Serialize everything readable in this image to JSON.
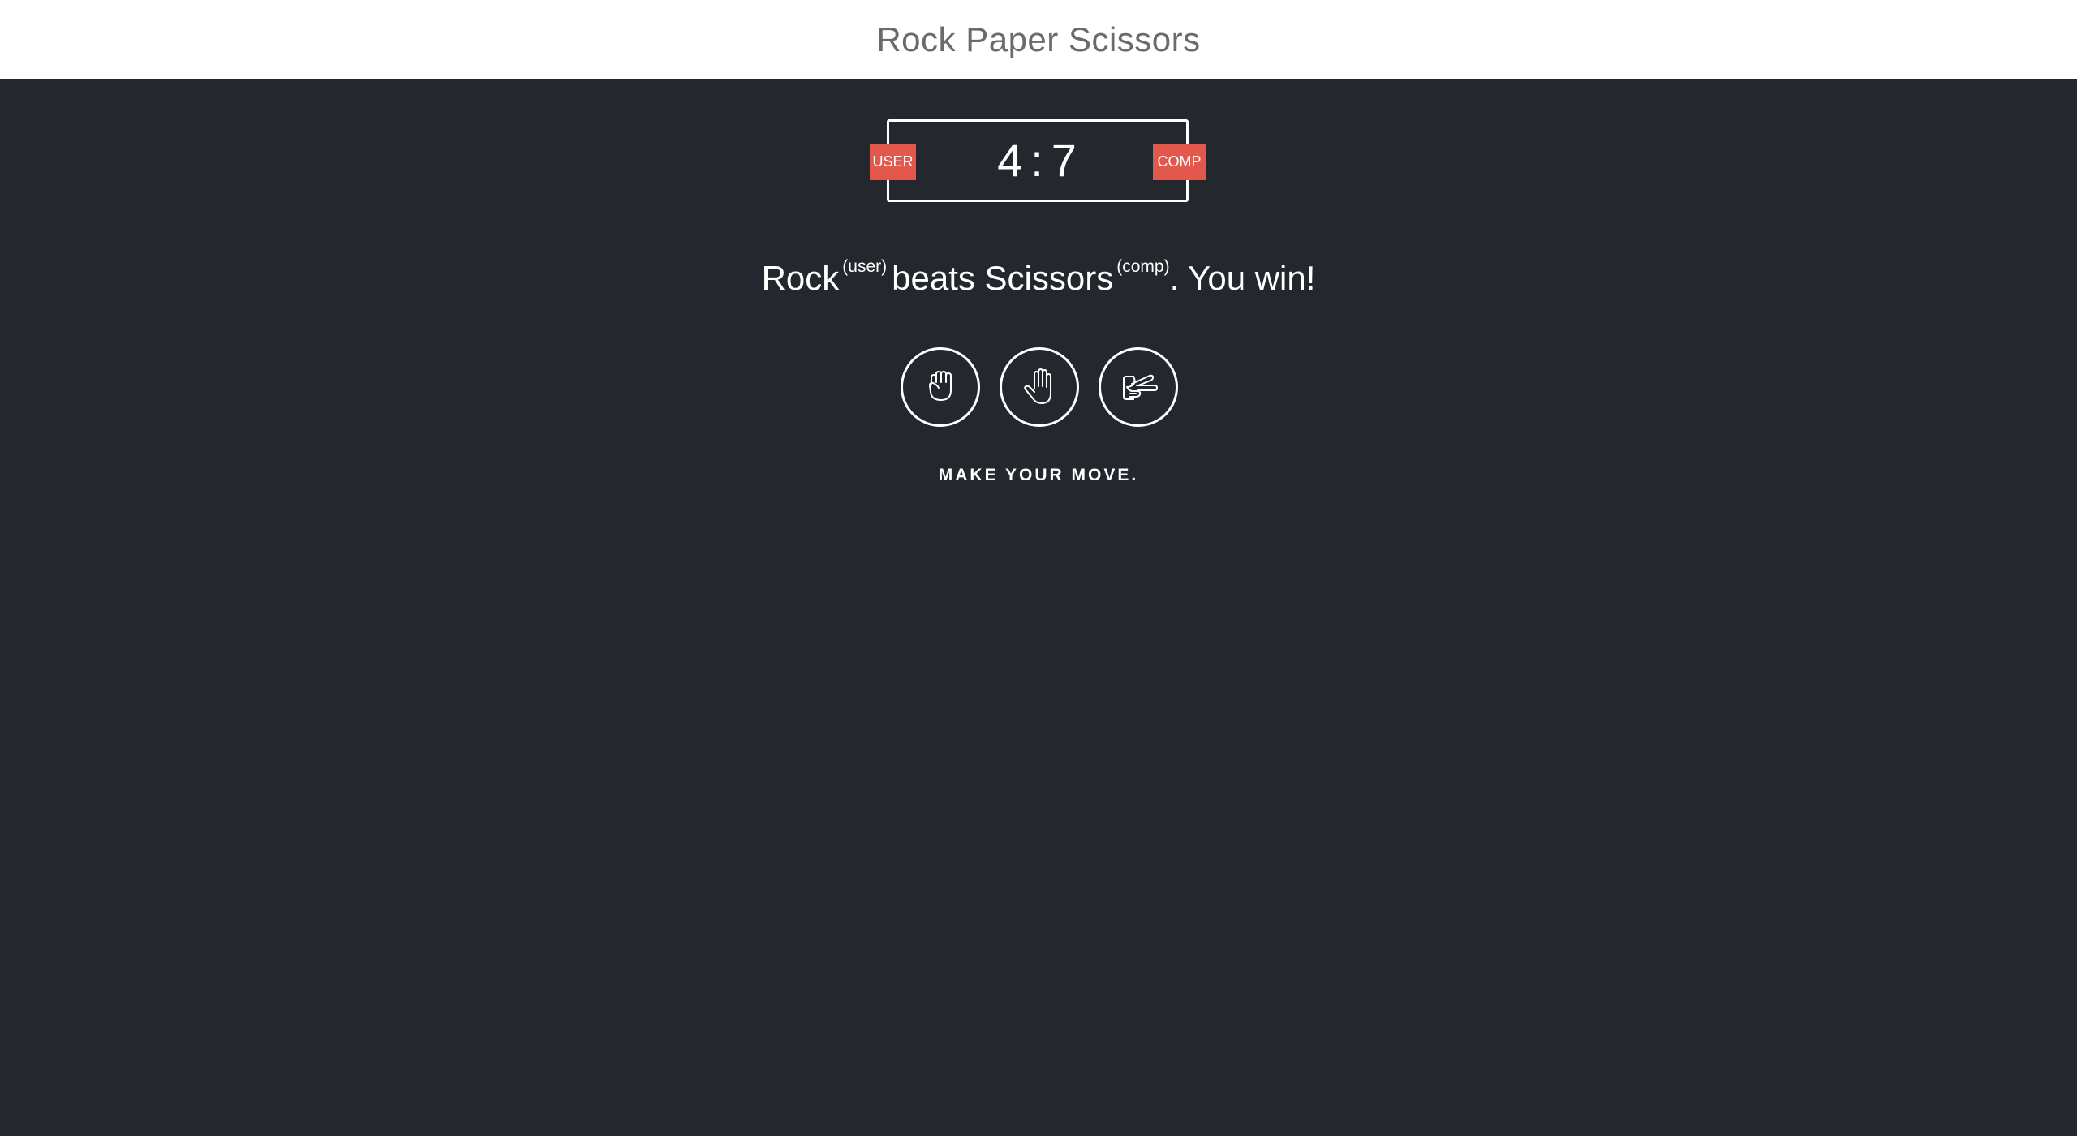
{
  "header": {
    "title": "Rock Paper Scissors"
  },
  "scoreboard": {
    "user_label": "USER",
    "comp_label": "COMP",
    "user_score": "4",
    "separator": ":",
    "comp_score": "7"
  },
  "result": {
    "user_move": "Rock",
    "user_tag": "(user)",
    "verb": "beats",
    "comp_move": "Scissors",
    "comp_tag": "(comp)",
    "outcome": ". You win!"
  },
  "choices": [
    {
      "name": "rock",
      "icon": "rock-hand-icon"
    },
    {
      "name": "paper",
      "icon": "paper-hand-icon"
    },
    {
      "name": "scissors",
      "icon": "scissors-hand-icon"
    }
  ],
  "prompt": "MAKE YOUR MOVE.",
  "colors": {
    "header_bg": "#ffffff",
    "page_bg": "#24272e",
    "badge": "#e2584d",
    "text": "#ffffff"
  }
}
